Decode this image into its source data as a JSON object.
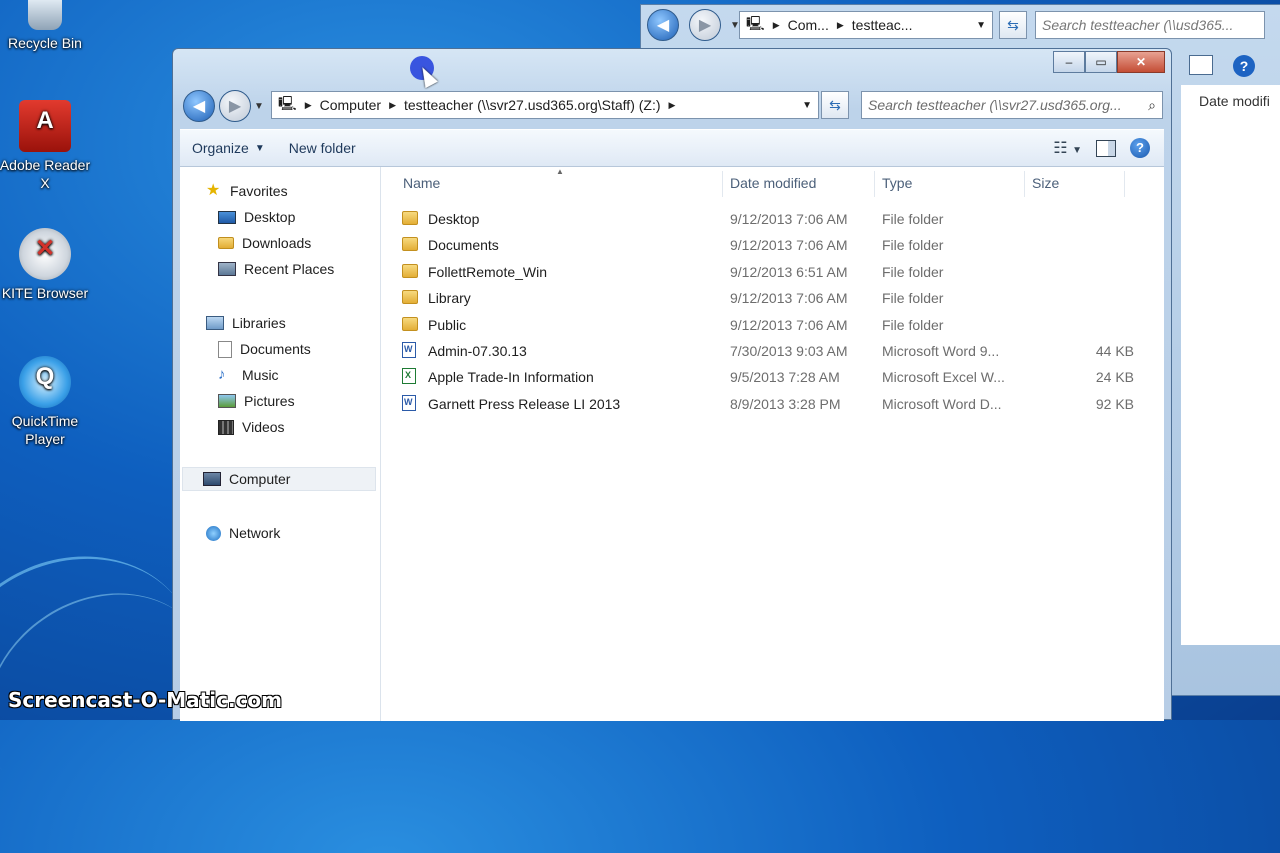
{
  "desktop": {
    "icons": [
      {
        "label": "Recycle Bin",
        "icon": "recycle-bin-icon"
      },
      {
        "label": "Adobe Reader X",
        "icon": "adobe-reader-icon"
      },
      {
        "label": "KITE Browser",
        "icon": "kite-browser-icon"
      },
      {
        "label": "QuickTime Player",
        "icon": "quicktime-icon"
      }
    ],
    "watermark": "Screencast-O-Matic.com"
  },
  "back_window": {
    "address": {
      "crumbs": [
        "Com...",
        "testteac..."
      ]
    },
    "search_placeholder": "Search testteacher (\\\\usd365...",
    "column_fragment": "Date modifi"
  },
  "window": {
    "controls": {
      "minimize": "–",
      "maximize": "▭",
      "close": "✕"
    },
    "address": {
      "crumbs": [
        "Computer",
        "testteacher (\\\\svr27.usd365.org\\Staff) (Z:)"
      ]
    },
    "search_placeholder": "Search testteacher (\\\\svr27.usd365.org...",
    "toolbar": {
      "organize": "Organize",
      "new_folder": "New folder"
    },
    "nav_pane": {
      "favorites": {
        "label": "Favorites",
        "items": [
          "Desktop",
          "Downloads",
          "Recent Places"
        ]
      },
      "libraries": {
        "label": "Libraries",
        "items": [
          "Documents",
          "Music",
          "Pictures",
          "Videos"
        ]
      },
      "computer": "Computer",
      "network": "Network"
    },
    "columns": {
      "name": "Name",
      "date": "Date modified",
      "type": "Type",
      "size": "Size"
    },
    "files": [
      {
        "name": "Desktop",
        "date": "9/12/2013 7:06 AM",
        "type": "File folder",
        "size": "",
        "kind": "folder"
      },
      {
        "name": "Documents",
        "date": "9/12/2013 7:06 AM",
        "type": "File folder",
        "size": "",
        "kind": "folder"
      },
      {
        "name": "FollettRemote_Win",
        "date": "9/12/2013 6:51 AM",
        "type": "File folder",
        "size": "",
        "kind": "folder"
      },
      {
        "name": "Library",
        "date": "9/12/2013 7:06 AM",
        "type": "File folder",
        "size": "",
        "kind": "folder"
      },
      {
        "name": "Public",
        "date": "9/12/2013 7:06 AM",
        "type": "File folder",
        "size": "",
        "kind": "folder"
      },
      {
        "name": "Admin-07.30.13",
        "date": "7/30/2013 9:03 AM",
        "type": "Microsoft Word 9...",
        "size": "44 KB",
        "kind": "word"
      },
      {
        "name": "Apple Trade-In Information",
        "date": "9/5/2013 7:28 AM",
        "type": "Microsoft Excel W...",
        "size": "24 KB",
        "kind": "excel"
      },
      {
        "name": "Garnett Press Release LI 2013",
        "date": "8/9/2013 3:28 PM",
        "type": "Microsoft Word D...",
        "size": "92 KB",
        "kind": "word"
      }
    ]
  }
}
